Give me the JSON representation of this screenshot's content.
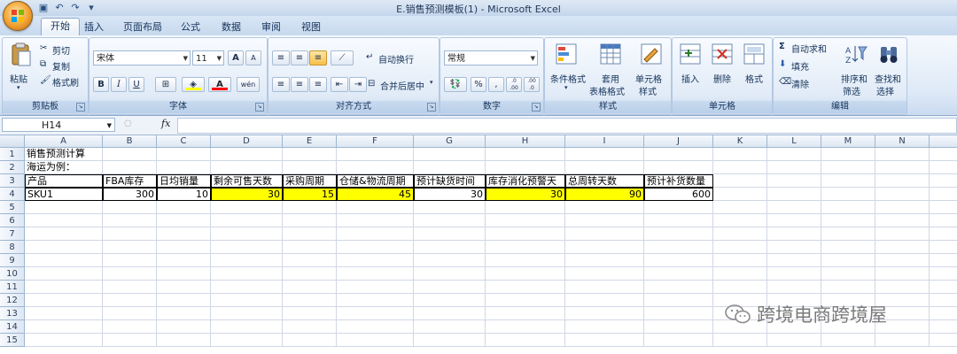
{
  "window": {
    "title": "E.销售预测模板(1) - Microsoft Excel"
  },
  "ribbon": {
    "tabs": [
      "开始",
      "插入",
      "页面布局",
      "公式",
      "数据",
      "审阅",
      "视图"
    ],
    "clipboard": {
      "group": "剪贴板",
      "paste": "粘贴",
      "cut": "剪切",
      "copy": "复制",
      "format_painter": "格式刷"
    },
    "font": {
      "group": "字体",
      "name": "宋体",
      "size": "11",
      "grow": "A",
      "shrink": "A",
      "bold": "B",
      "italic": "I",
      "underline": "U",
      "fill_color": "#ffff00",
      "font_color": "#ff0000",
      "wen": "wén"
    },
    "alignment": {
      "group": "对齐方式",
      "wrap": "自动换行",
      "merge": "合并后居中"
    },
    "number": {
      "group": "数字",
      "format": "常规",
      "percent": "%",
      "comma": ",",
      "inc": ".0 .00",
      "dec": ".00 .0"
    },
    "styles": {
      "group": "样式",
      "cond1": "条件格式",
      "table1": "套用",
      "table2": "表格格式",
      "cell1": "单元格",
      "cell2": "样式"
    },
    "cells": {
      "group": "单元格",
      "insert": "插入",
      "delete": "删除",
      "format": "格式"
    },
    "editing": {
      "group": "编辑",
      "autosum": "自动求和",
      "fill": "填充",
      "clear": "清除",
      "sort1": "排序和",
      "sort2": "筛选",
      "find1": "查找和",
      "find2": "选择"
    }
  },
  "formula_bar": {
    "name_box": "H14",
    "fx": "fx",
    "content": ""
  },
  "sheet": {
    "columns": [
      "A",
      "B",
      "C",
      "D",
      "E",
      "F",
      "G",
      "H",
      "I",
      "J",
      "K",
      "L",
      "M",
      "N",
      "O"
    ],
    "rows": [
      "1",
      "2",
      "3",
      "4",
      "5",
      "6",
      "7",
      "8",
      "9",
      "10",
      "11",
      "12",
      "13",
      "14",
      "15"
    ],
    "A1": "销售预测计算",
    "A2": "海运为例：",
    "headers": [
      "产品",
      "FBA库存",
      "日均销量",
      "剩余可售天数",
      "采购周期",
      "仓储&物流周期",
      "预计缺货时间",
      "库存消化预警天",
      "总周转天数",
      "预计补货数量"
    ],
    "row4": [
      "SKU1",
      "300",
      "10",
      "30",
      "15",
      "45",
      "30",
      "30",
      "90",
      "600"
    ],
    "highlight_color": "#ffff00"
  },
  "watermark": "跨境电商跨境屋"
}
